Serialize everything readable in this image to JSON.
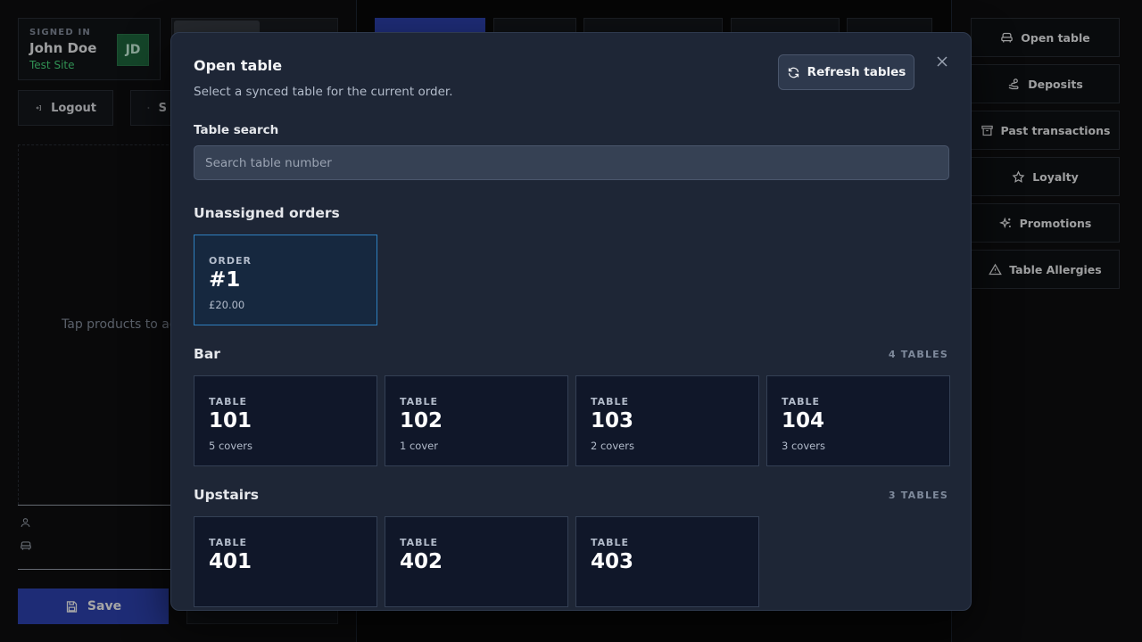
{
  "signin": {
    "label": "SIGNED IN",
    "name": "John Doe",
    "site": "Test Site",
    "initials": "JD"
  },
  "left": {
    "logout_label": "Logout",
    "settings_label": "S",
    "empty_cart_text": "Tap products to ad",
    "save_label": "Save"
  },
  "actions": [
    {
      "label": "Open table",
      "icon": "sofa-icon"
    },
    {
      "label": "Deposits",
      "icon": "hand-coins-icon"
    },
    {
      "label": "Past transactions",
      "icon": "archive-icon"
    },
    {
      "label": "Loyalty",
      "icon": "star-icon"
    },
    {
      "label": "Promotions",
      "icon": "sparkles-icon"
    },
    {
      "label": "Table Allergies",
      "icon": "alert-triangle-icon"
    }
  ],
  "modal": {
    "title": "Open table",
    "subtitle": "Select a synced table for the current order.",
    "refresh_label": "Refresh tables",
    "search_label": "Table search",
    "search_placeholder": "Search table number",
    "unassigned_title": "Unassigned orders",
    "unassigned_orders": [
      {
        "kind": "ORDER",
        "number": "#1",
        "meta": "£20.00"
      }
    ],
    "sections": [
      {
        "title": "Bar",
        "count": "4 TABLES",
        "tables": [
          {
            "kind": "TABLE",
            "number": "101",
            "meta": "5 covers"
          },
          {
            "kind": "TABLE",
            "number": "102",
            "meta": "1 cover"
          },
          {
            "kind": "TABLE",
            "number": "103",
            "meta": "2 covers"
          },
          {
            "kind": "TABLE",
            "number": "104",
            "meta": "3 covers"
          }
        ]
      },
      {
        "title": "Upstairs",
        "count": "3 TABLES",
        "tables": [
          {
            "kind": "TABLE",
            "number": "401",
            "meta": ""
          },
          {
            "kind": "TABLE",
            "number": "402",
            "meta": ""
          },
          {
            "kind": "TABLE",
            "number": "403",
            "meta": ""
          }
        ]
      }
    ]
  },
  "colors": {
    "accent": "#2f44b5",
    "selected_border": "#2f7fbf",
    "site_green": "#4ade80"
  }
}
